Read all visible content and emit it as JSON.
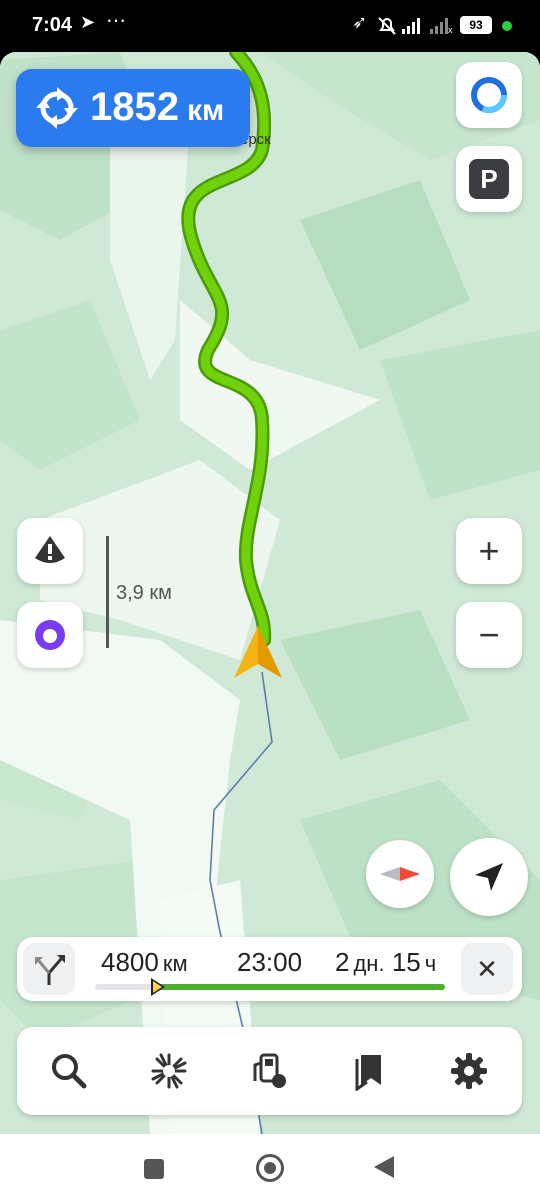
{
  "status_bar": {
    "time": "7:04",
    "battery": "93",
    "icons": [
      "telegram-icon",
      "more-icon",
      "location-arrow-icon",
      "mute-icon",
      "signal-icon",
      "signal-x-icon"
    ]
  },
  "map": {
    "place_label": "ёрск",
    "scale_label": "3,9 км",
    "colors": {
      "base": "#cfe9d6",
      "route": "#6fd20a",
      "road": "#ffffff",
      "river": "#5b7fa8"
    }
  },
  "distance_badge": {
    "value": "1852",
    "unit": "км",
    "icon": "roundabout-icon"
  },
  "right_controls": {
    "alice_icon": "alice-ring-icon",
    "parking_label": "P",
    "zoom_in": "+",
    "zoom_out": "−"
  },
  "left_controls": {
    "warning_icon": "road-alert-icon",
    "voice_icon": "alice-voice-icon"
  },
  "route_bar": {
    "distance_value": "4800",
    "distance_unit": "км",
    "arrival_time": "23:00",
    "duration_days": "2",
    "duration_days_unit": "дн.",
    "duration_hours": "15",
    "duration_hours_unit": "ч",
    "progress": 0.17,
    "close_label": "✕"
  },
  "bottom_bar": {
    "items": [
      "search-icon",
      "route-overview-icon",
      "fuel-station-icon",
      "bookmarks-icon",
      "settings-icon"
    ]
  },
  "system_nav": [
    "recent-apps-button",
    "home-button",
    "back-button"
  ]
}
